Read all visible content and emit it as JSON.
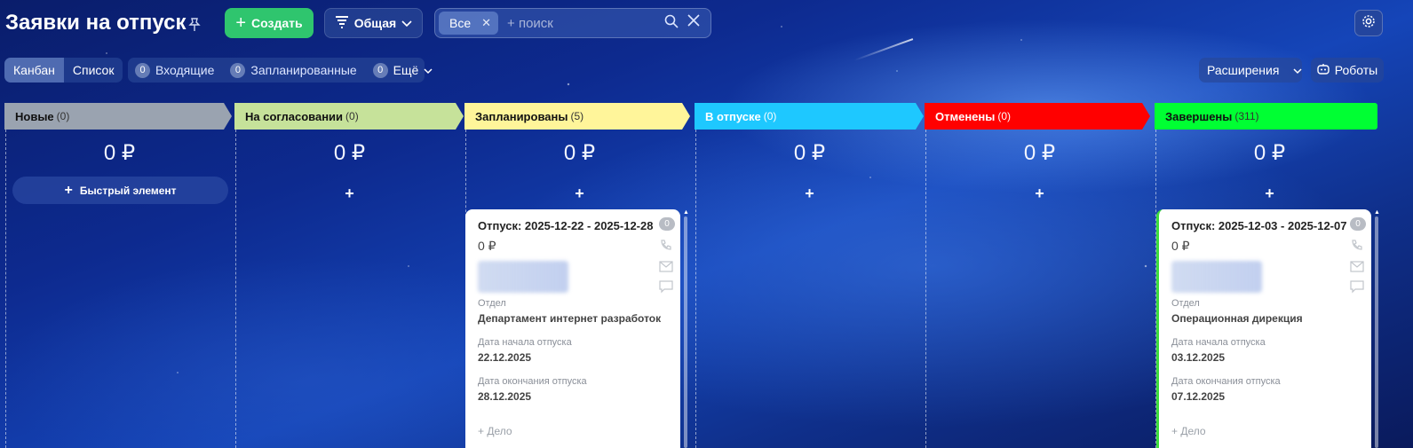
{
  "page_title": "Заявки на отпуск",
  "header": {
    "create_label": "Создать",
    "filter_label": "Общая",
    "search": {
      "chip": "Все",
      "placeholder": "+ поиск"
    }
  },
  "toolbar": {
    "views": [
      "Канбан",
      "Список"
    ],
    "counters": [
      {
        "count": "0",
        "label": "Входящие"
      },
      {
        "count": "0",
        "label": "Запланированные"
      },
      {
        "count": "0",
        "label": "Ещё"
      }
    ],
    "extensions_label": "Расширения",
    "robots_label": "Роботы"
  },
  "columns": [
    {
      "name": "Новые",
      "count": "(0)",
      "color": "#9aa3b0",
      "sum": "0 ₽"
    },
    {
      "name": "На согласовании",
      "count": "(0)",
      "color": "#c6e29a",
      "sum": "0 ₽"
    },
    {
      "name": "Запланированы",
      "count": "(5)",
      "color": "#fff59a",
      "sum": "0 ₽"
    },
    {
      "name": "В отпуске",
      "count": "(0)",
      "color": "#1ec8ff",
      "sum": "0 ₽"
    },
    {
      "name": "Отменены",
      "count": "(0)",
      "color": "#ff0000",
      "sum": "0 ₽"
    },
    {
      "name": "Завершены",
      "count": "(311)",
      "color": "#00ff33",
      "sum": "0 ₽"
    }
  ],
  "quick_add_label": "Быстрый элемент",
  "add_symbol": "+",
  "cards": [
    {
      "title": "Отпуск: 2025-12-22 - 2025-12-28",
      "sum": "0 ₽",
      "badge": "0",
      "dept_label": "Отдел",
      "dept_value": "Департамент интернет разработок",
      "start_label": "Дата начала отпуска",
      "start_value": "22.12.2025",
      "end_label": "Дата окончания отпуска",
      "end_value": "28.12.2025",
      "deal_label": "+ Дело"
    },
    {
      "title": "Отпуск: 2025-12-03 - 2025-12-07",
      "sum": "0 ₽",
      "badge": "0",
      "dept_label": "Отдел",
      "dept_value": "Операционная дирекция",
      "start_label": "Дата начала отпуска",
      "start_value": "03.12.2025",
      "end_label": "Дата окончания отпуска",
      "end_value": "07.12.2025",
      "deal_label": "+ Дело"
    }
  ]
}
